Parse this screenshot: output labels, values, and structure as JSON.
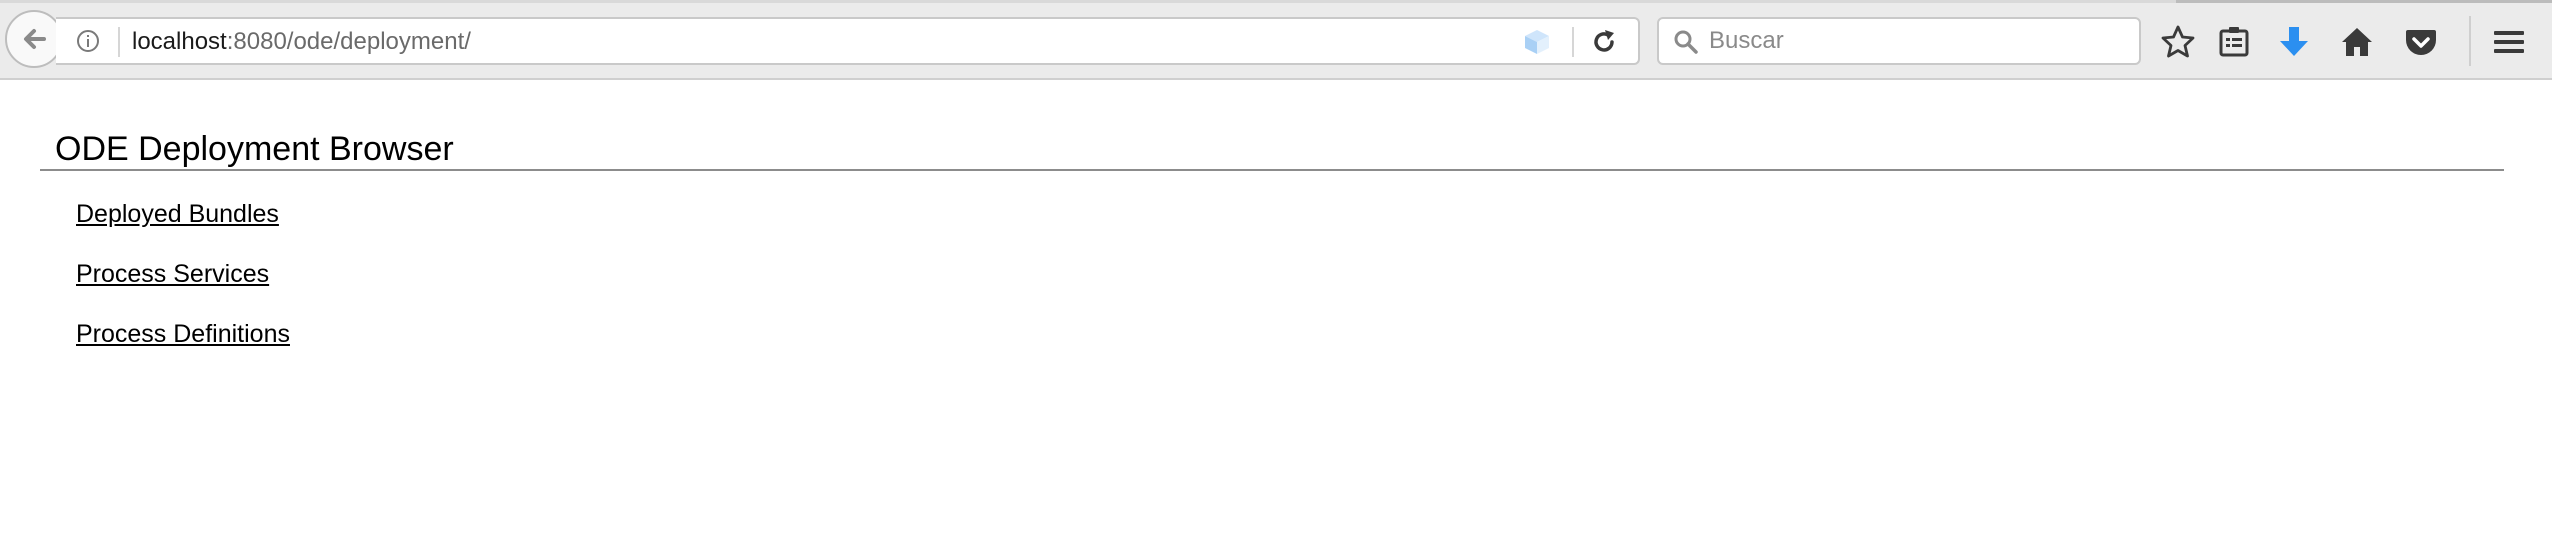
{
  "browser": {
    "url": {
      "host": "localhost",
      "rest": ":8080/ode/deployment/"
    },
    "search": {
      "placeholder": "Buscar",
      "value": ""
    },
    "icons": {
      "back": "back-arrow-icon",
      "site_info": "info-icon",
      "extension": "cube-icon",
      "reload": "reload-icon",
      "search": "search-icon",
      "bookmark": "star-icon",
      "reading_list": "reading-list-icon",
      "downloads": "download-arrow-icon",
      "home": "home-icon",
      "pocket": "pocket-icon",
      "menu": "hamburger-menu-icon"
    },
    "colors": {
      "toolbar_bg": "#ebebeb",
      "download_accent": "#2b8ff0"
    }
  },
  "page": {
    "title": "ODE Deployment Browser",
    "links": [
      {
        "label": "Deployed Bundles"
      },
      {
        "label": "Process Services"
      },
      {
        "label": "Process Definitions"
      }
    ]
  }
}
